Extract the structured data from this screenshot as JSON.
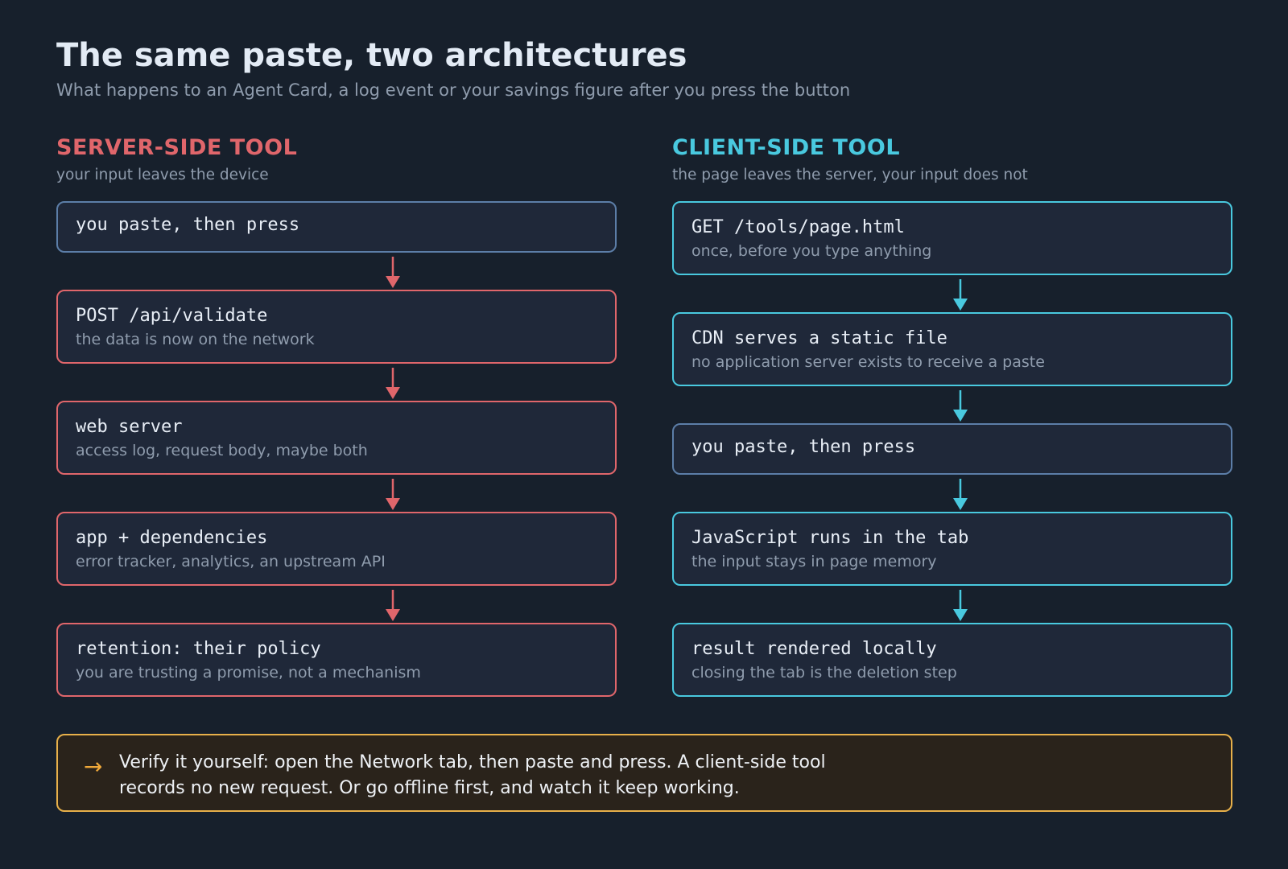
{
  "title": "The same paste, two architectures",
  "subtitle": "What happens to an Agent Card, a log event or your savings figure after you press the button",
  "server": {
    "heading": "SERVER-SIDE TOOL",
    "subheading": "your input leaves the device",
    "steps": [
      {
        "code": "you paste, then press",
        "note": ""
      },
      {
        "code": "POST /api/validate",
        "note": "the data is now on the network"
      },
      {
        "code": "web server",
        "note": "access log, request body, maybe both"
      },
      {
        "code": "app + dependencies",
        "note": "error tracker, analytics, an upstream API"
      },
      {
        "code": "retention: their policy",
        "note": "you are trusting a promise, not a mechanism"
      }
    ]
  },
  "client": {
    "heading": "CLIENT-SIDE TOOL",
    "subheading": "the page leaves the server, your input does not",
    "steps": [
      {
        "code": "GET /tools/page.html",
        "note": "once, before you type anything"
      },
      {
        "code": "CDN serves a static file",
        "note": "no application server exists to receive a paste"
      },
      {
        "code": "you paste, then press",
        "note": ""
      },
      {
        "code": "JavaScript runs in the tab",
        "note": "the input stays in page memory"
      },
      {
        "code": "result rendered locally",
        "note": "closing the tab is the deletion step"
      }
    ]
  },
  "callout": {
    "icon": "arrow-right-icon",
    "glyph": "→",
    "text": "Verify it yourself: open the Network tab, then paste and press. A client-side tool records no new request. Or go offline first, and watch it keep working."
  },
  "colors": {
    "background": "#17202c",
    "server_accent": "#e0666b",
    "client_accent": "#49c9df",
    "neutral_border": "#5c7ea8",
    "callout_border": "#e7b04a"
  }
}
